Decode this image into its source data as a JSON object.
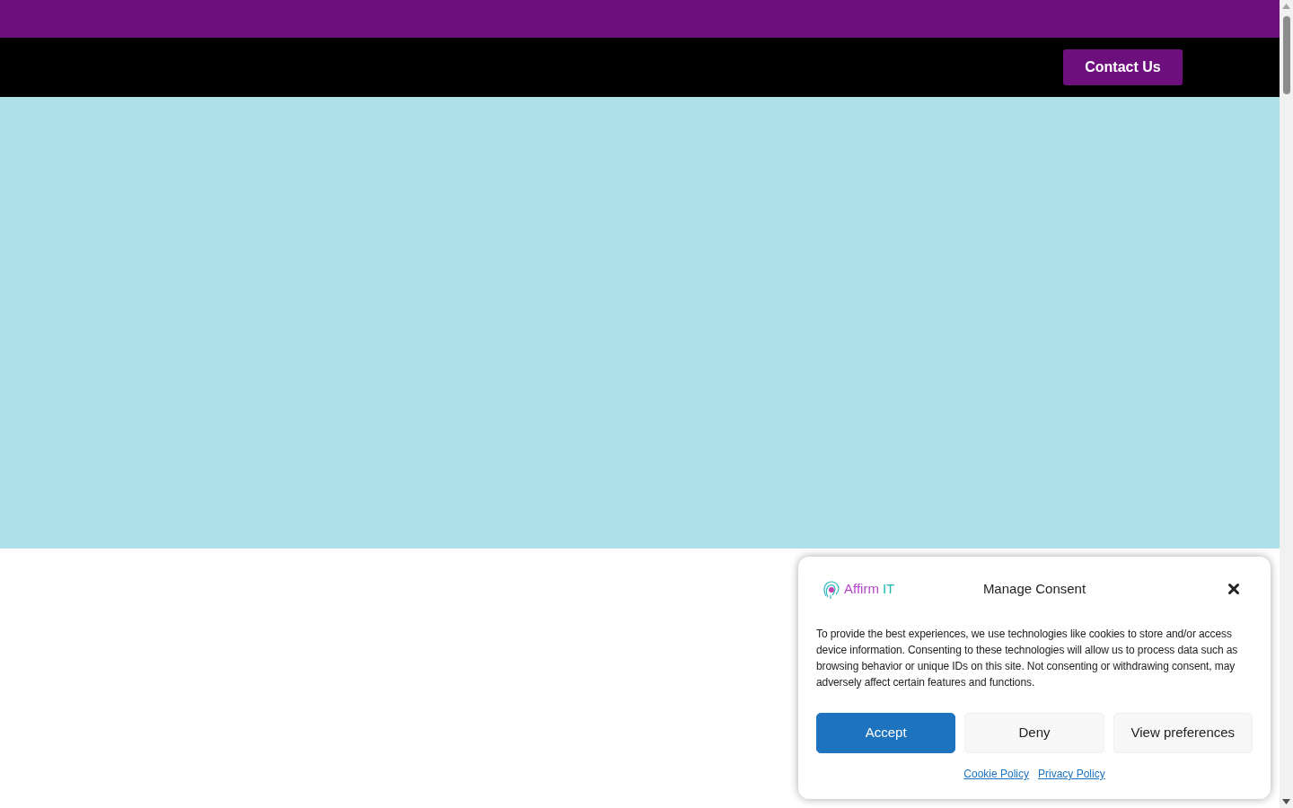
{
  "header": {
    "contact_button": "Contact Us"
  },
  "consent": {
    "logo": [
      "Affirm",
      "IT"
    ],
    "title": "Manage Consent",
    "message": "To provide the best experiences, we use technologies like cookies to store and/or access device information. Consenting to these technologies will allow us to process data such as browsing behavior or unique IDs on this site. Not consenting or withdrawing consent, may adversely affect certain features and functions.",
    "buttons": [
      {
        "label": "Accept",
        "kind": "primary"
      },
      {
        "label": "Deny",
        "kind": "secondary"
      },
      {
        "label": "View preferences",
        "kind": "secondary"
      }
    ],
    "links": [
      "Cookie Policy",
      "Privacy Policy"
    ]
  }
}
